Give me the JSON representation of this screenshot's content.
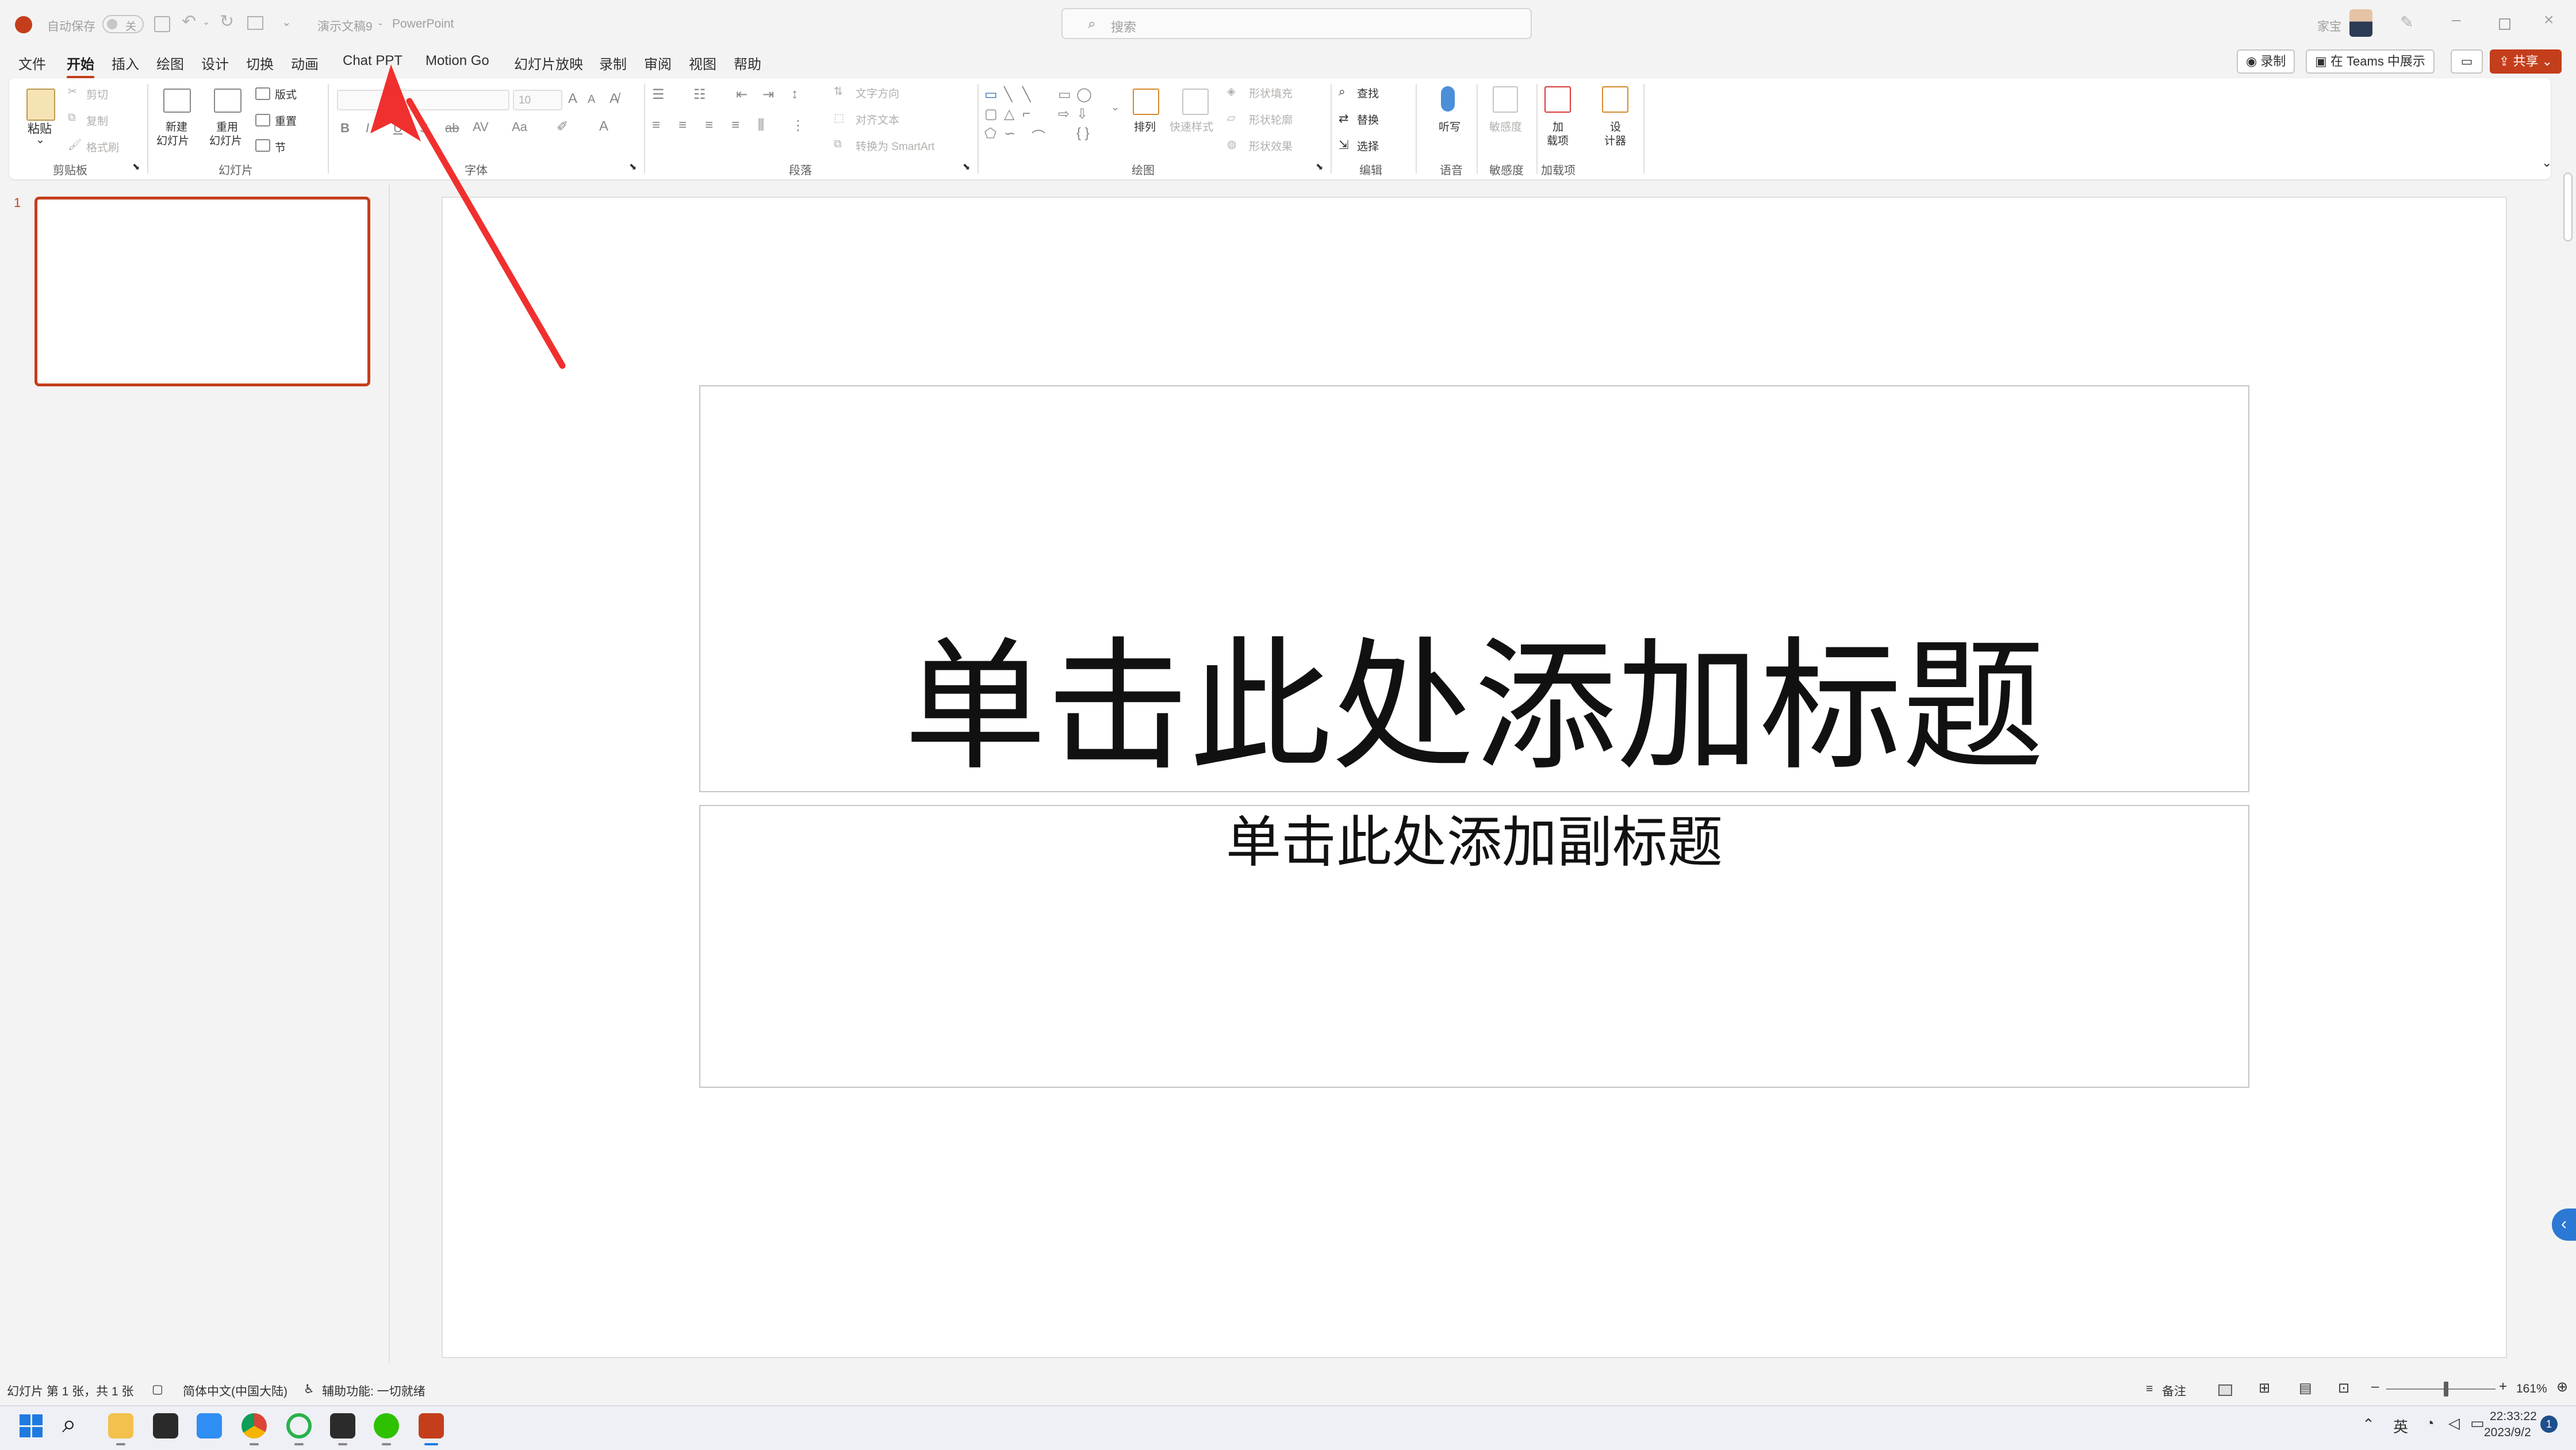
{
  "titlebar": {
    "autosave_label": "自动保存",
    "autosave_state": "关",
    "doc_name": "演示文稿9",
    "separator": "-",
    "app_name": "PowerPoint",
    "search_placeholder": "搜索",
    "user_name": "家宝"
  },
  "tabs": [
    "文件",
    "开始",
    "插入",
    "绘图",
    "设计",
    "切换",
    "动画",
    "Chat PPT",
    "Motion Go",
    "幻灯片放映",
    "录制",
    "审阅",
    "视图",
    "帮助"
  ],
  "active_tab": "开始",
  "right_buttons": {
    "record": "录制",
    "teams": "在 Teams 中展示",
    "share": "共享"
  },
  "ribbon": {
    "clipboard": {
      "paste": "粘贴",
      "cut": "剪切",
      "copy": "复制",
      "format_painter": "格式刷",
      "label": "剪贴板"
    },
    "slides": {
      "new_slide_1": "新建",
      "new_slide_2": "幻灯片",
      "reuse_1": "重用",
      "reuse_2": "幻灯片",
      "layout": "版式",
      "reset": "重置",
      "section": "节",
      "label": "幻灯片"
    },
    "font": {
      "size": "10",
      "label": "字体"
    },
    "paragraph": {
      "text_direction": "文字方向",
      "align_text": "对齐文本",
      "smartart": "转换为 SmartArt",
      "label": "段落"
    },
    "drawing": {
      "arrange": "排列",
      "quick_styles": "快速样式",
      "shape_fill": "形状填充",
      "shape_outline": "形状轮廓",
      "shape_effects": "形状效果",
      "label": "绘图"
    },
    "editing": {
      "find": "查找",
      "replace": "替换",
      "select": "选择",
      "label": "编辑"
    },
    "voice": {
      "dictate": "听写",
      "label": "语音"
    },
    "sensitivity": {
      "name": "敏感度",
      "label": "敏感度"
    },
    "addins": {
      "addins_1": "加",
      "addins_2": "载项",
      "label": "加载项"
    },
    "designer": {
      "designer_1": "设",
      "designer_2": "计器"
    }
  },
  "thumbnails": {
    "slide_number": "1"
  },
  "slide": {
    "title_placeholder": "单击此处添加标题",
    "subtitle_placeholder": "单击此处添加副标题"
  },
  "statusbar": {
    "slide_info": "幻灯片 第 1 张，共 1 张",
    "language": "简体中文(中国大陆)",
    "accessibility": "辅助功能: 一切就绪",
    "notes": "备注",
    "zoom": "161%"
  },
  "taskbar": {
    "ime": "英",
    "time": "22:33:22",
    "date": "2023/9/2",
    "notification_count": "1"
  },
  "colors": {
    "accent": "#c43e1c",
    "arrow": "#f0302e",
    "collapse_button": "#2b78d5"
  }
}
